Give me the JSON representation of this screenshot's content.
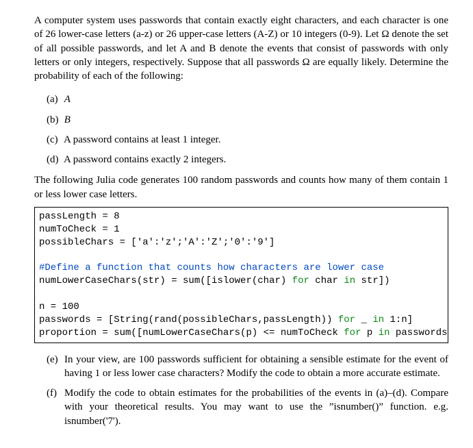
{
  "intro": "A computer system uses passwords that contain exactly eight characters, and each character is one of 26 lower-case letters (a-z) or 26 upper-case letters (A-Z) or 10 integers (0-9). Let Ω denote the set of all possible passwords, and let A and B denote the events that consist of passwords with only letters or only integers, respectively. Suppose that all passwords Ω are equally likely. Determine the probability of each of the following:",
  "parts": [
    {
      "label": "(a)",
      "text_i": "A"
    },
    {
      "label": "(b)",
      "text_i": "B"
    },
    {
      "label": "(c)",
      "text": "A password contains at least 1 integer."
    },
    {
      "label": "(d)",
      "text": "A password contains exactly 2 integers."
    }
  ],
  "mid": "The following Julia code generates 100 random passwords and counts how many of them contain 1 or less lower case letters.",
  "code": {
    "l1": "passLength = 8",
    "l2": "numToCheck = 1",
    "l3": "possibleChars = ['a':'z';'A':'Z';'0':'9']",
    "blank1": "",
    "c1": "#Define a function that counts how characters are lower case",
    "l4a": "numLowerCaseChars(str) = sum([islower(char) ",
    "l4b": "for",
    "l4c": " char ",
    "l4d": "in",
    "l4e": " str])",
    "blank2": "",
    "l5": "n = 100",
    "l6a": "passwords = [String(rand(possibleChars,passLength)) ",
    "l6b": "for",
    "l6c": " _ ",
    "l6d": "in",
    "l6e": " 1:n]",
    "l7a": "proportion = sum([numLowerCaseChars(p) <= numToCheck ",
    "l7b": "for",
    "l7c": " p ",
    "l7d": "in",
    "l7e": " passwords])/n"
  },
  "parts2": [
    {
      "label": "(e)",
      "text": "In your view, are 100 passwords sufficient for obtaining a sensible estimate for the event of having 1 or less lower case characters? Modify the code to obtain a more accurate estimate."
    },
    {
      "label": "(f)",
      "text": "Modify the code to obtain estimates for the probabilities of the events in (a)–(d). Compare with your theoretical results. You may want to use the ”isnumber()” function. e.g. isnumber('7')."
    }
  ]
}
